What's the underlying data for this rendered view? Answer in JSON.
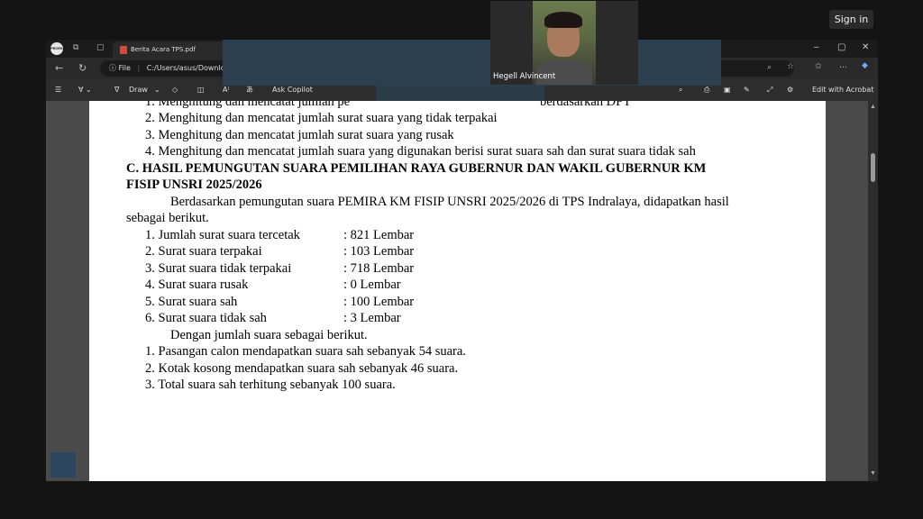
{
  "meeting": {
    "sign_in_label": "Sign in",
    "participant_name": "Hegell Alvincent"
  },
  "browser": {
    "tab_title": "Berita Acara TPS.pdf",
    "url_scheme": "File",
    "url_path": "C:/Users/asus/Downlo",
    "profile_label": "PROFILE"
  },
  "pdf_toolbar": {
    "draw_label": "Draw",
    "ask_copilot_label": "Ask Copilot",
    "edit_acrobat_label": "Edit with Acrobat"
  },
  "document": {
    "top_list": [
      "1. Menghitung dan mencatat jumlah pe",
      "berdasarkan DPT",
      "2. Menghitung dan mencatat jumlah surat suara yang tidak terpakai",
      "3. Menghitung dan mencatat jumlah surat suara yang rusak",
      "4. Menghitung dan mencatat jumlah suara yang digunakan berisi surat suara sah dan surat suara tidak sah"
    ],
    "section_heading_line1": "C. HASIL PEMUNGUTAN SUARA PEMILIHAN RAYA GUBERNUR DAN WAKIL GUBERNUR KM",
    "section_heading_line2": "FISIP UNSRI 2025/2026",
    "paragraph_line1": "Berdasarkan pemungutan suara PEMIRA KM FISIP UNSRI 2025/2026 di TPS Indralaya, didapatkan hasil",
    "paragraph_line2": "sebagai berikut.",
    "results": [
      {
        "label": "1. Jumlah surat suara tercetak",
        "value": ": 821 Lembar"
      },
      {
        "label": "2. Surat suara terpakai",
        "value": ": 103 Lembar"
      },
      {
        "label": "3. Surat suara tidak terpakai",
        "value": ": 718 Lembar"
      },
      {
        "label": "4. Surat suara rusak",
        "value": ": 0 Lembar"
      },
      {
        "label": "5. Surat suara sah",
        "value": ": 100 Lembar"
      },
      {
        "label": "6. Surat suara tidak sah",
        "value": ": 3 Lembar"
      }
    ],
    "intro_second": "Dengan jumlah suara sebagai berikut.",
    "summary": [
      "1. Pasangan calon mendapatkan suara sah sebanyak 54 suara.",
      "2. Kotak kosong mendapatkan suara sah sebanyak 46 suara.",
      "3. Total suara sah terhitung sebanyak 100 suara."
    ]
  },
  "colors": {
    "meeting_bg": "#141414",
    "browser_chrome": "#202020",
    "pdf_page": "#ffffff",
    "pdf_viewer_bg": "#4a4a4a"
  }
}
